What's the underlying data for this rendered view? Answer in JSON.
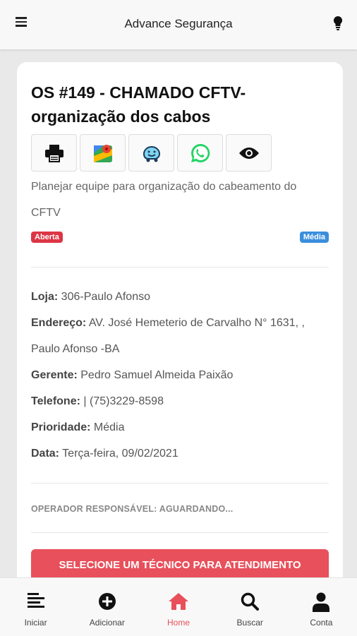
{
  "app": {
    "title": "Advance Segurança"
  },
  "order": {
    "title": "OS #149 - CHAMADO CFTV-organização dos cabos",
    "description": "Planejar equipe para organização do cabeamento do CFTV",
    "status": "Aberta",
    "priority_badge": "Média",
    "actions": [
      "print-icon",
      "maps-icon",
      "waze-icon",
      "whatsapp-icon",
      "eye-icon"
    ]
  },
  "details": {
    "store_label": "Loja:",
    "store": "306-Paulo Afonso",
    "address_label": "Endereço:",
    "address": "AV. José Hemeterio de Carvalho N° 1631, , Paulo Afonso -BA",
    "manager_label": "Gerente:",
    "manager": "Pedro Samuel Almeida Paixão",
    "phone_label": "Telefone:",
    "phone": "| (75)3229-8598",
    "priority_label": "Prioridade:",
    "priority": "Média",
    "date_label": "Data:",
    "date": "Terça-feira, 09/02/2021"
  },
  "operator": "OPERADOR RESPONSÁVEL: AGUARDANDO...",
  "cta_label": "SELECIONE UM TÉCNICO PARA ATENDIMENTO",
  "nav": {
    "items": [
      {
        "label": "Iniciar",
        "icon": "menu-lines-icon"
      },
      {
        "label": "Adicionar",
        "icon": "plus-circle-icon"
      },
      {
        "label": "Home",
        "icon": "home-icon"
      },
      {
        "label": "Buscar",
        "icon": "search-icon"
      },
      {
        "label": "Conta",
        "icon": "user-icon"
      }
    ],
    "active": "Home"
  },
  "colors": {
    "accent": "#e8505b",
    "status": "#dc3545",
    "priority": "#3a8edc"
  }
}
